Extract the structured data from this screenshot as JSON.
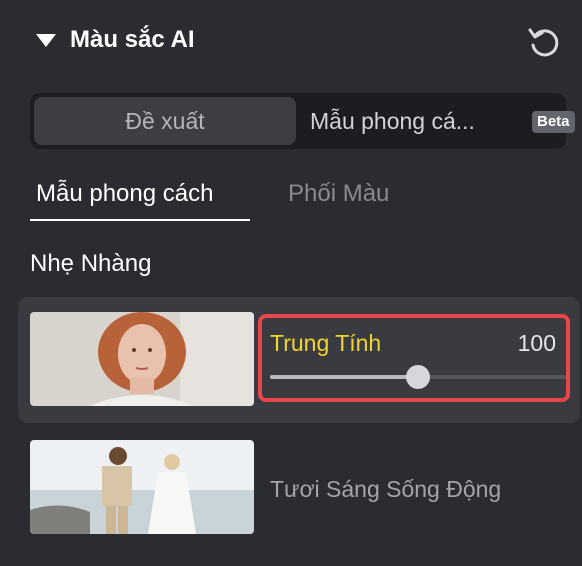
{
  "panel": {
    "title": "Màu sắc AI",
    "collapse_icon": "caret-down-icon",
    "reset_icon": "reset-icon"
  },
  "segmented": {
    "left_label": "Đề xuất",
    "right_label": "Mẫu phong cá...",
    "badge": "Beta",
    "selected": "Đề xuất"
  },
  "tabs": [
    {
      "label": "Mẫu phong cách",
      "active": true
    },
    {
      "label": "Phối Màu",
      "active": false
    }
  ],
  "section_title": "Nhẹ Nhàng",
  "items": [
    {
      "label": "Trung Tính",
      "value": "100",
      "selected": true,
      "slider_fraction": 0.5
    },
    {
      "label": "Tươi Sáng Sống Động",
      "selected": false
    }
  ],
  "colors": {
    "accent_label": "#f2d42e",
    "highlight_border": "#e8464a",
    "background": "#2b2c31"
  }
}
